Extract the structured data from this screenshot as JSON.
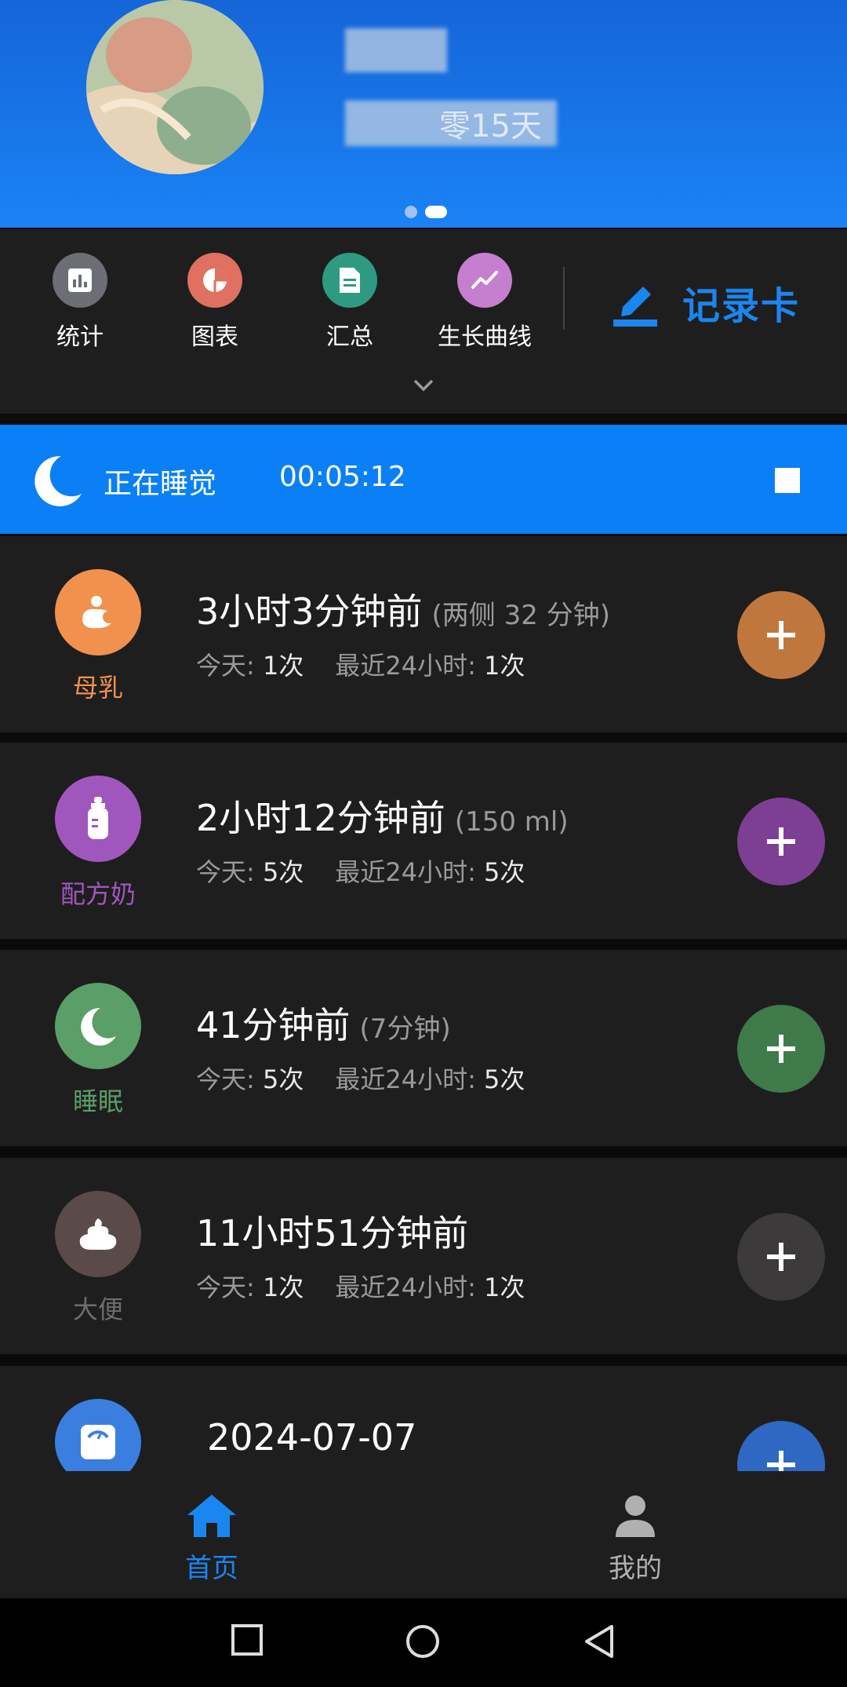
{
  "header": {
    "age_text": "零15天",
    "pager_active_index": 1
  },
  "tools": {
    "items": [
      {
        "label": "统计",
        "icon": "bar-chart-icon",
        "color": "#6b6e75"
      },
      {
        "label": "图表",
        "icon": "pie-chart-icon",
        "color": "#e0705f"
      },
      {
        "label": "汇总",
        "icon": "document-icon",
        "color": "#2f9a82"
      },
      {
        "label": "生长曲线",
        "icon": "trend-line-icon",
        "color": "#c57fce"
      }
    ],
    "record_label": "记录卡"
  },
  "sleep_bar": {
    "status": "正在睡觉",
    "timer": "00:05:12"
  },
  "cards": [
    {
      "name": "母乳",
      "time": "3小时3分钟前",
      "note": "(两侧 32 分钟)",
      "today_label": "今天:",
      "today": "1次",
      "recent_label": "最近24小时:",
      "recent": "1次",
      "icon": "breastfeeding-icon",
      "color": "#f0914e",
      "name_color": "#f0914e",
      "add_color": "#c0773e"
    },
    {
      "name": "配方奶",
      "time": "2小时12分钟前",
      "note": "(150 ml)",
      "today_label": "今天:",
      "today": "5次",
      "recent_label": "最近24小时:",
      "recent": "5次",
      "icon": "baby-bottle-icon",
      "color": "#a057bd",
      "name_color": "#a057bd",
      "add_color": "#7d3f94"
    },
    {
      "name": "睡眠",
      "time": "41分钟前",
      "note": "(7分钟)",
      "today_label": "今天:",
      "today": "5次",
      "recent_label": "最近24小时:",
      "recent": "5次",
      "icon": "moon-icon",
      "color": "#5a9e68",
      "name_color": "#5a9e68",
      "add_color": "#3f7a4a"
    },
    {
      "name": "大便",
      "time": "11小时51分钟前",
      "note": "",
      "today_label": "今天:",
      "today": "1次",
      "recent_label": "最近24小时:",
      "recent": "1次",
      "icon": "poop-icon",
      "color": "#5a4a48",
      "name_color": "#6e6e6e",
      "add_color": "#3c3a3a"
    },
    {
      "name": "",
      "time": "2024-07-07",
      "note": "",
      "icon": "scale-icon",
      "color": "#3a7fe0",
      "add_color": "#2f68c2"
    }
  ],
  "bottom_nav": {
    "home_label": "首页",
    "mine_label": "我的",
    "active_color": "#1a86f0",
    "inactive_color": "#b0b0b0"
  }
}
